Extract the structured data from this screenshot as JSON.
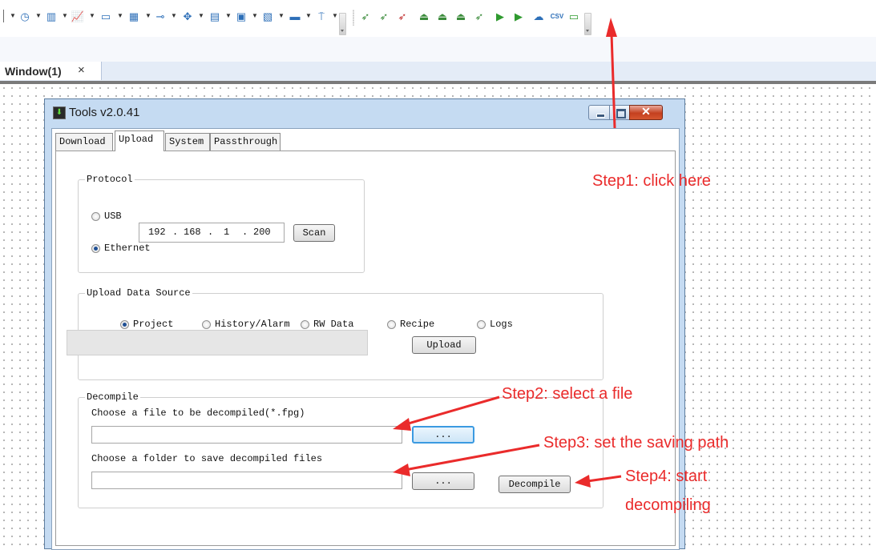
{
  "toolbar": {
    "icons": [
      "clock-icon",
      "meter-icon",
      "trend-chart-icon",
      "numeric-display-icon",
      "table-icon",
      "slider-icon",
      "move-icon",
      "pipe-icon",
      "note-icon",
      "gradient-icon",
      "bar-icon",
      "tree-icon",
      "download-icon",
      "download-alt-icon",
      "download-cancel-icon",
      "upload-device-icon",
      "upload-alt-icon",
      "upload-alt2-icon",
      "decompile-icon",
      "run-icon",
      "run-alt-icon",
      "cloud-icon",
      "csv-icon",
      "battery-icon"
    ]
  },
  "document_tab": {
    "label": "Window(1)",
    "close": "×"
  },
  "window": {
    "title": "Tools v2.0.41",
    "tabs": [
      "Download",
      "Upload",
      "System",
      "Passthrough"
    ],
    "active_tab": "Upload",
    "protocol": {
      "title": "Protocol",
      "usb_label": "USB",
      "ethernet_label": "Ethernet",
      "selected": "Ethernet",
      "ip": [
        "192",
        "168",
        "1",
        "200"
      ],
      "scan_label": "Scan"
    },
    "upload_source": {
      "title": "Upload Data Source",
      "options": [
        "Project",
        "History/Alarm",
        "RW Data",
        "Recipe",
        "Logs"
      ],
      "selected": "Project",
      "progress": 0,
      "upload_label": "Upload"
    },
    "decompile": {
      "title": "Decompile",
      "file_label": "Choose a file to be decompiled(*.fpg)",
      "file_value": "",
      "browse_label": "...",
      "folder_label": "Choose a folder to save decompiled files",
      "folder_value": "",
      "decompile_label": "Decompile"
    }
  },
  "annotations": {
    "color": "#ea2b2b",
    "step1": "Step1: click here",
    "step2": "Step2: select a file",
    "step3": "Step3: set the saving path",
    "step4_line1": "Step4: start",
    "step4_line2": "decompiling"
  }
}
